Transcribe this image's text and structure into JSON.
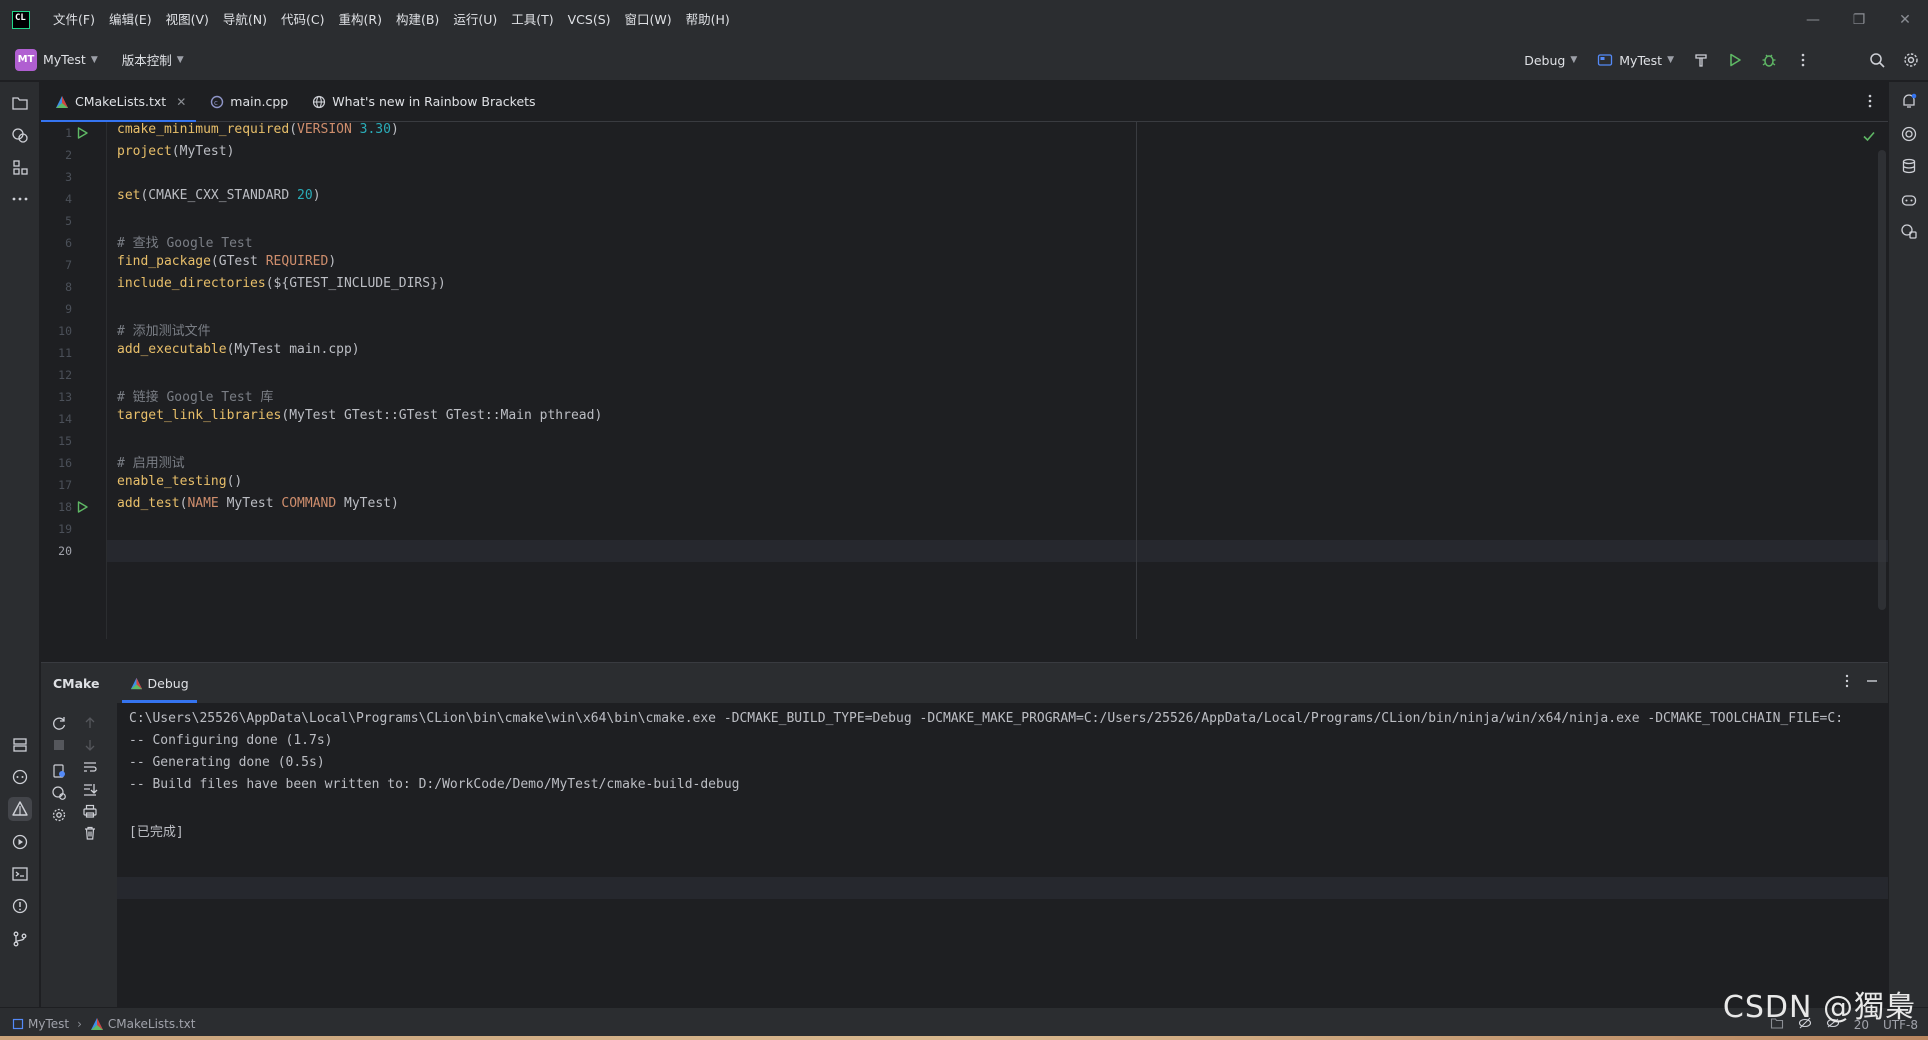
{
  "window": {
    "logo_text": "CL",
    "menu": [
      "文件(F)",
      "编辑(E)",
      "视图(V)",
      "导航(N)",
      "代码(C)",
      "重构(R)",
      "构建(B)",
      "运行(U)",
      "工具(T)",
      "VCS(S)",
      "窗口(W)",
      "帮助(H)"
    ],
    "controls": {
      "minimize": "—",
      "restore": "❐",
      "close": "✕"
    }
  },
  "toolbar": {
    "project_badge": "MT",
    "project_name": "MyTest",
    "vcs_label": "版本控制",
    "config_profile": "Debug",
    "run_config": "MyTest"
  },
  "editor_tabs": [
    {
      "label": "CMakeLists.txt",
      "icon": "cmake-icon",
      "active": true,
      "closable": true
    },
    {
      "label": "main.cpp",
      "icon": "cpp-file-icon",
      "active": false,
      "closable": false
    },
    {
      "label": "What's new in Rainbow Brackets",
      "icon": "globe-icon",
      "active": false,
      "closable": false
    }
  ],
  "editor": {
    "language": "CMake",
    "current_line": 20,
    "line_numbers": [
      "1",
      "2",
      "3",
      "4",
      "5",
      "6",
      "7",
      "8",
      "9",
      "10",
      "11",
      "12",
      "13",
      "14",
      "15",
      "16",
      "17",
      "18",
      "19",
      "20"
    ],
    "run_gutter_lines": [
      1,
      18
    ],
    "lines": [
      [
        {
          "t": "cmake_minimum_required",
          "c": "fn"
        },
        {
          "t": "(",
          "c": ""
        },
        {
          "t": "VERSION",
          "c": "kw"
        },
        {
          "t": " ",
          "c": ""
        },
        {
          "t": "3.30",
          "c": "num"
        },
        {
          "t": ")",
          "c": ""
        }
      ],
      [
        {
          "t": "project",
          "c": "fn"
        },
        {
          "t": "(MyTest)",
          "c": ""
        }
      ],
      [],
      [
        {
          "t": "set",
          "c": "fn"
        },
        {
          "t": "(CMAKE_CXX_STANDARD ",
          "c": ""
        },
        {
          "t": "20",
          "c": "num"
        },
        {
          "t": ")",
          "c": ""
        }
      ],
      [],
      [
        {
          "t": "# 查找 Google Test",
          "c": "cm"
        }
      ],
      [
        {
          "t": "find_package",
          "c": "fn"
        },
        {
          "t": "(GTest ",
          "c": ""
        },
        {
          "t": "REQUIRED",
          "c": "kw"
        },
        {
          "t": ")",
          "c": ""
        }
      ],
      [
        {
          "t": "include_directories",
          "c": "fn"
        },
        {
          "t": "(${GTEST_INCLUDE_DIRS})",
          "c": ""
        }
      ],
      [],
      [
        {
          "t": "# 添加测试文件",
          "c": "cm"
        }
      ],
      [
        {
          "t": "add_executable",
          "c": "fn"
        },
        {
          "t": "(MyTest main.cpp)",
          "c": ""
        }
      ],
      [],
      [
        {
          "t": "# 链接 Google Test 库",
          "c": "cm"
        }
      ],
      [
        {
          "t": "target_link_libraries",
          "c": "fn"
        },
        {
          "t": "(MyTest GTest::GTest GTest::Main pthread)",
          "c": ""
        }
      ],
      [],
      [
        {
          "t": "# 启用测试",
          "c": "cm"
        }
      ],
      [
        {
          "t": "enable_testing",
          "c": "fn"
        },
        {
          "t": "()",
          "c": ""
        }
      ],
      [
        {
          "t": "add_test",
          "c": "fn"
        },
        {
          "t": "(",
          "c": ""
        },
        {
          "t": "NAME",
          "c": "kw"
        },
        {
          "t": " MyTest ",
          "c": ""
        },
        {
          "t": "COMMAND",
          "c": "kw"
        },
        {
          "t": " MyTest)",
          "c": ""
        }
      ],
      [],
      []
    ]
  },
  "tool_window": {
    "title": "CMake",
    "tab": "Debug",
    "console_lines": [
      "C:\\Users\\25526\\AppData\\Local\\Programs\\CLion\\bin\\cmake\\win\\x64\\bin\\cmake.exe -DCMAKE_BUILD_TYPE=Debug -DCMAKE_MAKE_PROGRAM=C:/Users/25526/AppData/Local/Programs/CLion/bin/ninja/win/x64/ninja.exe -DCMAKE_TOOLCHAIN_FILE=C:",
      "-- Configuring done (1.7s)",
      "-- Generating done (0.5s)",
      "-- Build files have been written to: D:/WorkCode/Demo/MyTest/cmake-build-debug",
      "",
      "[已完成]"
    ]
  },
  "statusbar": {
    "breadcrumb": [
      "MyTest",
      "CMakeLists.txt"
    ],
    "right_items": [
      "20",
      "UTF-8"
    ]
  },
  "watermark": "CSDN @獨梟",
  "colors": {
    "accent": "#3574f0",
    "run_green": "#5fb865",
    "project_badge": "#b05fd1"
  }
}
